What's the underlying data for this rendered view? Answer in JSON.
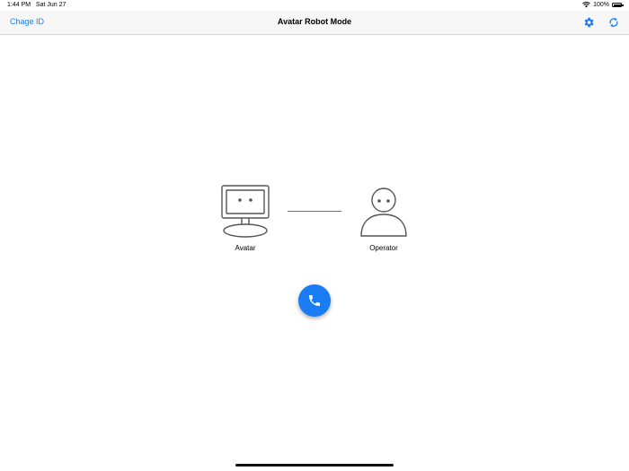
{
  "status_bar": {
    "time": "1:44 PM",
    "date": "Sat Jun 27",
    "battery": "100%"
  },
  "nav": {
    "left_button": "Chage ID",
    "title": "Avatar Robot Mode",
    "right_icons": [
      "gear-icon",
      "refresh-icon"
    ]
  },
  "diagram": {
    "avatar_label": "Avatar",
    "operator_label": "Operator"
  },
  "call": {
    "icon": "phone-icon"
  },
  "colors": {
    "accent": "#1a7cf5",
    "nav_background": "#f7f7f7",
    "line": "#6e6e6e"
  }
}
